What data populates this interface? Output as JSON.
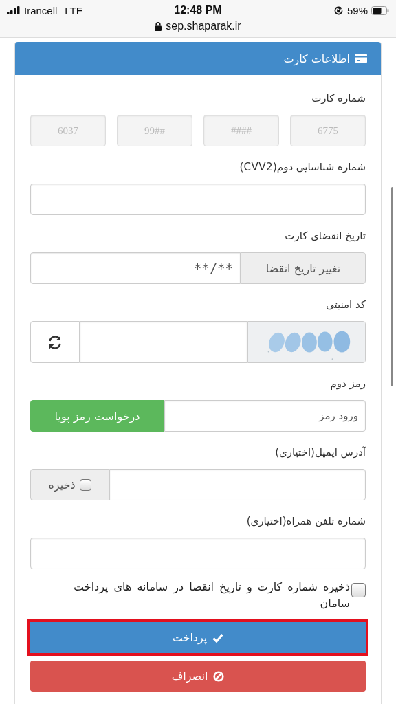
{
  "status_bar": {
    "carrier": "Irancell",
    "network": "LTE",
    "time": "12:48 PM",
    "battery": "59%",
    "url": "sep.shaparak.ir"
  },
  "panel": {
    "title": "اطلاعات کارت"
  },
  "fields": [
    {
      "kind": "card_number",
      "label": "شماره کارت",
      "parts": [
        {
          "value": "6775",
          "disabled": true
        },
        {
          "value": "####",
          "disabled": true
        },
        {
          "value": "99##",
          "disabled": true
        },
        {
          "value": "6037",
          "disabled": true
        }
      ]
    },
    {
      "kind": "text",
      "label": "شماره شناسایی دوم(CVV2)"
    },
    {
      "kind": "expiry",
      "label": "تاریخ انقضای کارت",
      "value": "**/**",
      "addon": "تغییر تاریخ انقضا"
    },
    {
      "kind": "captcha",
      "label": "کد امنیتی"
    },
    {
      "kind": "dynamic_password",
      "label": "رمز دوم",
      "placeholder": "ورود رمز",
      "button": "درخواست رمز پویا"
    },
    {
      "kind": "email",
      "label": "آدرس ایمیل(اختیاری)",
      "save_label": "ذخیره",
      "checked": false
    },
    {
      "kind": "text",
      "label": "شماره تلفن همراه(اختیاری)"
    }
  ],
  "save_card": {
    "label": "ذخیره شماره کارت و تاریخ انقضا در سامانه های پرداخت سامان",
    "checked": false
  },
  "buttons": [
    {
      "kind": "pay",
      "label": "پرداخت",
      "highlighted": true
    },
    {
      "kind": "cancel",
      "label": "انصراف",
      "highlighted": false
    }
  ]
}
